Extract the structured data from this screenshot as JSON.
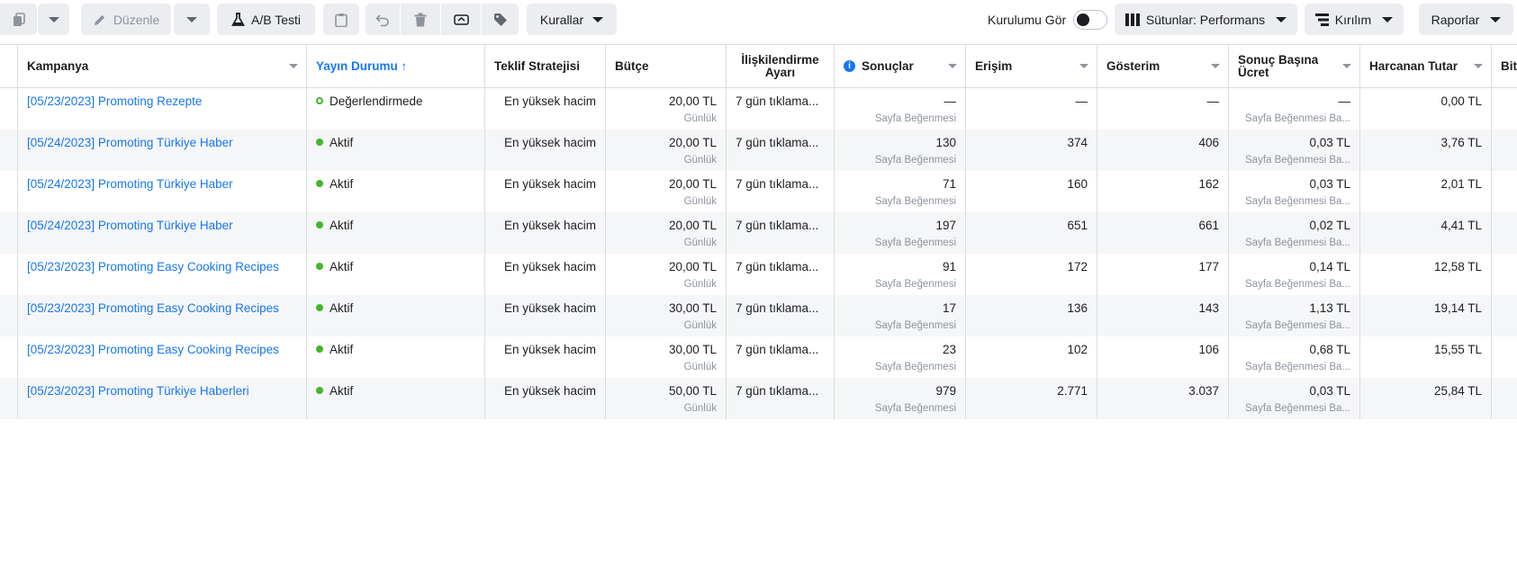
{
  "toolbar": {
    "edit_label": "Düzenle",
    "ab_test_label": "A/B Testi",
    "rules_label": "Kurallar",
    "view_setup_label": "Kurulumu Gör",
    "columns_label": "Sütunlar: Performans",
    "breakdown_label": "Kırılım",
    "reports_label": "Raporlar"
  },
  "columns": {
    "campaign": "Kampanya",
    "delivery": "Yayın Durumu ↑",
    "bid_strategy": "Teklif Stratejisi",
    "budget": "Bütçe",
    "attribution": "İlişkilendirme Ayarı",
    "results": "Sonuçlar",
    "reach": "Erişim",
    "impressions": "Gösterim",
    "cost_per_result": "Sonuç Başına Ücret",
    "amount_spent": "Harcanan Tutar",
    "ends": "Bitiş"
  },
  "rows": [
    {
      "campaign": "[05/23/2023] Promoting Rezepte",
      "delivery": "Değerlendirmede",
      "delivery_state": "pending",
      "bid": "En yüksek hacim",
      "budget": "20,00 TL",
      "budget_type": "Günlük",
      "attribution": "7 gün tıklama...",
      "results": "—",
      "results_type": "Sayfa Beğenmesi",
      "reach": "—",
      "impressions": "—",
      "cpr": "—",
      "cpr_type": "Sayfa Beğenmesi Ba...",
      "spent": "0,00 TL"
    },
    {
      "campaign": "[05/24/2023] Promoting Türkiye Haber",
      "delivery": "Aktif",
      "delivery_state": "active",
      "bid": "En yüksek hacim",
      "budget": "20,00 TL",
      "budget_type": "Günlük",
      "attribution": "7 gün tıklama...",
      "results": "130",
      "results_type": "Sayfa Beğenmesi",
      "reach": "374",
      "impressions": "406",
      "cpr": "0,03 TL",
      "cpr_type": "Sayfa Beğenmesi Ba...",
      "spent": "3,76 TL"
    },
    {
      "campaign": "[05/24/2023] Promoting Türkiye Haber",
      "delivery": "Aktif",
      "delivery_state": "active",
      "bid": "En yüksek hacim",
      "budget": "20,00 TL",
      "budget_type": "Günlük",
      "attribution": "7 gün tıklama...",
      "results": "71",
      "results_type": "Sayfa Beğenmesi",
      "reach": "160",
      "impressions": "162",
      "cpr": "0,03 TL",
      "cpr_type": "Sayfa Beğenmesi Ba...",
      "spent": "2,01 TL"
    },
    {
      "campaign": "[05/24/2023] Promoting Türkiye Haber",
      "delivery": "Aktif",
      "delivery_state": "active",
      "bid": "En yüksek hacim",
      "budget": "20,00 TL",
      "budget_type": "Günlük",
      "attribution": "7 gün tıklama...",
      "results": "197",
      "results_type": "Sayfa Beğenmesi",
      "reach": "651",
      "impressions": "661",
      "cpr": "0,02 TL",
      "cpr_type": "Sayfa Beğenmesi Ba...",
      "spent": "4,41 TL"
    },
    {
      "campaign": "[05/23/2023] Promoting Easy Cooking Recipes",
      "delivery": "Aktif",
      "delivery_state": "active",
      "bid": "En yüksek hacim",
      "budget": "20,00 TL",
      "budget_type": "Günlük",
      "attribution": "7 gün tıklama...",
      "results": "91",
      "results_type": "Sayfa Beğenmesi",
      "reach": "172",
      "impressions": "177",
      "cpr": "0,14 TL",
      "cpr_type": "Sayfa Beğenmesi Ba...",
      "spent": "12,58 TL"
    },
    {
      "campaign": "[05/23/2023] Promoting Easy Cooking Recipes",
      "delivery": "Aktif",
      "delivery_state": "active",
      "bid": "En yüksek hacim",
      "budget": "30,00 TL",
      "budget_type": "Günlük",
      "attribution": "7 gün tıklama...",
      "results": "17",
      "results_type": "Sayfa Beğenmesi",
      "reach": "136",
      "impressions": "143",
      "cpr": "1,13 TL",
      "cpr_type": "Sayfa Beğenmesi Ba...",
      "spent": "19,14 TL"
    },
    {
      "campaign": "[05/23/2023] Promoting Easy Cooking Recipes",
      "delivery": "Aktif",
      "delivery_state": "active",
      "bid": "En yüksek hacim",
      "budget": "30,00 TL",
      "budget_type": "Günlük",
      "attribution": "7 gün tıklama...",
      "results": "23",
      "results_type": "Sayfa Beğenmesi",
      "reach": "102",
      "impressions": "106",
      "cpr": "0,68 TL",
      "cpr_type": "Sayfa Beğenmesi Ba...",
      "spent": "15,55 TL"
    },
    {
      "campaign": "[05/23/2023] Promoting Türkiye Haberleri",
      "delivery": "Aktif",
      "delivery_state": "active",
      "bid": "En yüksek hacim",
      "budget": "50,00 TL",
      "budget_type": "Günlük",
      "attribution": "7 gün tıklama...",
      "results": "979",
      "results_type": "Sayfa Beğenmesi",
      "reach": "2.771",
      "impressions": "3.037",
      "cpr": "0,03 TL",
      "cpr_type": "Sayfa Beğenmesi Ba...",
      "spent": "25,84 TL"
    }
  ],
  "colors": {
    "link": "#1877f2",
    "active_status": "#42b72a",
    "row_alt": "#f5f6f7",
    "muted": "#8d949e"
  }
}
